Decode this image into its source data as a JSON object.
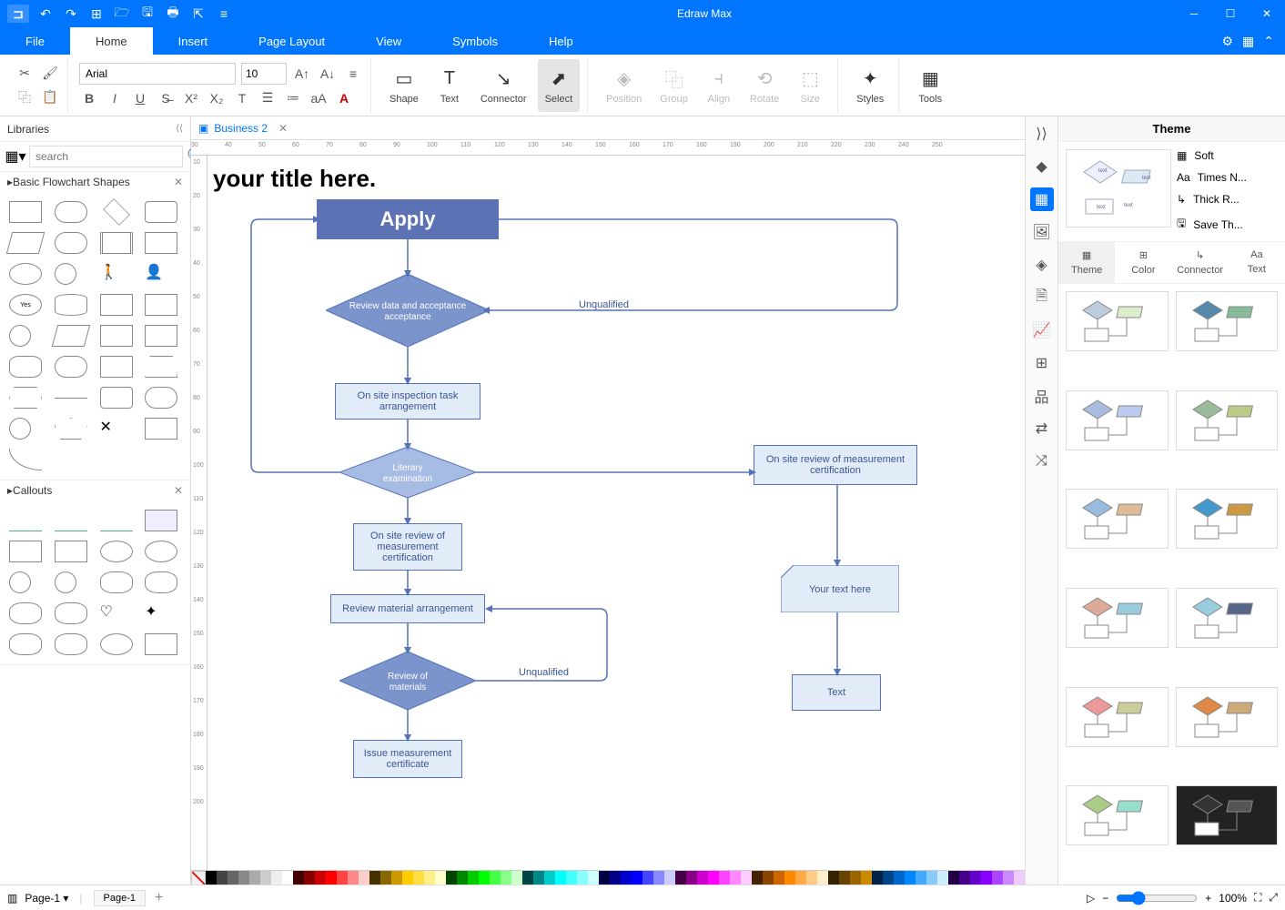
{
  "app": {
    "title": "Edraw Max"
  },
  "menu": {
    "file": "File",
    "home": "Home",
    "insert": "Insert",
    "page_layout": "Page Layout",
    "view": "View",
    "symbols": "Symbols",
    "help": "Help"
  },
  "ribbon": {
    "font_name": "Arial",
    "font_size": "10",
    "shape": "Shape",
    "text": "Text",
    "connector": "Connector",
    "select": "Select",
    "position": "Position",
    "group": "Group",
    "align": "Align",
    "rotate": "Rotate",
    "size": "Size",
    "styles": "Styles",
    "tools": "Tools"
  },
  "libraries": {
    "title": "Libraries",
    "search_placeholder": "search",
    "categories": [
      {
        "name": "Basic Flowchart Shapes"
      },
      {
        "name": "Callouts"
      }
    ]
  },
  "document": {
    "tab_name": "Business 2"
  },
  "canvas": {
    "title_text": "your title here.",
    "apply": "Apply",
    "review_data": "Review data and acceptance",
    "unqualified1": "Unqualified",
    "onsite_task": "On site inspection task arrangement",
    "literary": "Literary examination",
    "onsite_review_right": "On site review of measurement certification",
    "onsite_review_left": "On site review of measurement certification",
    "your_text_here": "Your text here",
    "review_material_arr": "Review material arrangement",
    "review_materials": "Review of materials",
    "unqualified2": "Unqualified",
    "text_box": "Text",
    "issue_cert": "Issue measurement certificate"
  },
  "theme_panel": {
    "title": "Theme",
    "soft": "Soft",
    "times": "Times N...",
    "thick": "Thick R...",
    "save": "Save Th...",
    "tabs": {
      "theme": "Theme",
      "color": "Color",
      "connector": "Connector",
      "text": "Text"
    }
  },
  "status": {
    "page_dropdown": "Page-1",
    "page_tab": "Page-1",
    "zoom": "100%"
  },
  "ruler_h": [
    30,
    40,
    50,
    60,
    70,
    80,
    90,
    100,
    110,
    120,
    130,
    140,
    150,
    160,
    170,
    180,
    190,
    200,
    210,
    220,
    230,
    240,
    250
  ],
  "ruler_v": [
    10,
    20,
    30,
    40,
    50,
    60,
    70,
    80,
    90,
    100,
    110,
    120,
    130,
    140,
    150,
    160,
    170,
    180,
    190,
    200
  ]
}
